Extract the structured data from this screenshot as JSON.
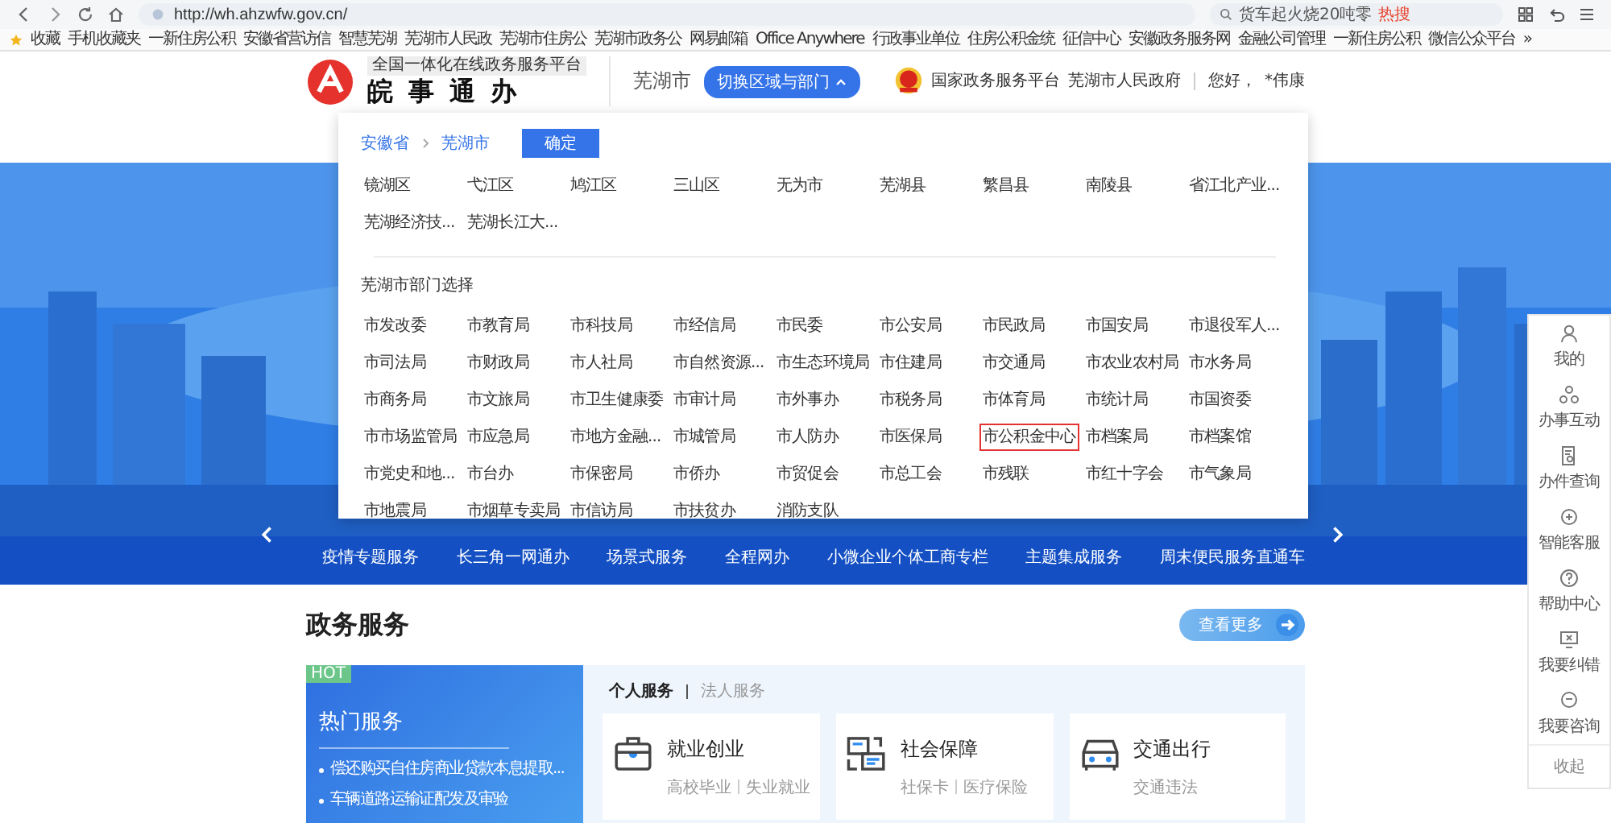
{
  "browser": {
    "url": "http://wh.ahzwfw.gov.cn/",
    "search": "货车起火烧20吨零",
    "search_badge": "热搜",
    "bookmarks": [
      "收藏",
      "手机收藏夹",
      "一新住房公积",
      "安徽省营访信",
      "智慧芜湖",
      "芜湖市人民政",
      "芜湖市住房公",
      "芜湖市政务公",
      "网易邮箱",
      "Office Anywhere",
      "行政事业单位",
      "住房公积金统",
      "征信中心",
      "安徽政务服务网",
      "金融公司管理",
      "一新住房公积",
      "微信公众平台",
      "»"
    ]
  },
  "header": {
    "tagline": "全国一体化在线政务服务平台",
    "logo_text": "皖 事 通 办",
    "city": "芜湖市",
    "switch_button": "切换区域与部门",
    "links": [
      "国家政务服务平台",
      "芜湖市人民政府"
    ],
    "greeting": "您好，",
    "user": "*伟康"
  },
  "picker": {
    "breadcrumb": [
      "安徽省",
      "芜湖市"
    ],
    "confirm": "确定",
    "regions": [
      "镜湖区",
      "弋江区",
      "鸠江区",
      "三山区",
      "无为市",
      "芜湖县",
      "繁昌县",
      "南陵县",
      "省江北产业...",
      "芜湖经济技...",
      "芜湖长江大..."
    ],
    "dept_title": "芜湖市部门选择",
    "departments": [
      {
        "label": "市发改委",
        "selected": false
      },
      {
        "label": "市教育局",
        "selected": false
      },
      {
        "label": "市科技局",
        "selected": false
      },
      {
        "label": "市经信局",
        "selected": false
      },
      {
        "label": "市民委",
        "selected": false
      },
      {
        "label": "市公安局",
        "selected": false
      },
      {
        "label": "市民政局",
        "selected": false
      },
      {
        "label": "市国安局",
        "selected": false
      },
      {
        "label": "市退役军人...",
        "selected": false
      },
      {
        "label": "市司法局",
        "selected": false
      },
      {
        "label": "市财政局",
        "selected": false
      },
      {
        "label": "市人社局",
        "selected": false
      },
      {
        "label": "市自然资源...",
        "selected": false
      },
      {
        "label": "市生态环境局",
        "selected": false
      },
      {
        "label": "市住建局",
        "selected": false
      },
      {
        "label": "市交通局",
        "selected": false
      },
      {
        "label": "市农业农村局",
        "selected": false
      },
      {
        "label": "市水务局",
        "selected": false
      },
      {
        "label": "市商务局",
        "selected": false
      },
      {
        "label": "市文旅局",
        "selected": false
      },
      {
        "label": "市卫生健康委",
        "selected": false
      },
      {
        "label": "市审计局",
        "selected": false
      },
      {
        "label": "市外事办",
        "selected": false
      },
      {
        "label": "市税务局",
        "selected": false
      },
      {
        "label": "市体育局",
        "selected": false
      },
      {
        "label": "市统计局",
        "selected": false
      },
      {
        "label": "市国资委",
        "selected": false
      },
      {
        "label": "市市场监管局",
        "selected": false
      },
      {
        "label": "市应急局",
        "selected": false
      },
      {
        "label": "市地方金融...",
        "selected": false
      },
      {
        "label": "市城管局",
        "selected": false
      },
      {
        "label": "市人防办",
        "selected": false
      },
      {
        "label": "市医保局",
        "selected": false
      },
      {
        "label": "市公积金中心",
        "selected": true
      },
      {
        "label": "市档案局",
        "selected": false
      },
      {
        "label": "市档案馆",
        "selected": false
      },
      {
        "label": "市党史和地...",
        "selected": false
      },
      {
        "label": "市台办",
        "selected": false
      },
      {
        "label": "市保密局",
        "selected": false
      },
      {
        "label": "市侨办",
        "selected": false
      },
      {
        "label": "市贸促会",
        "selected": false
      },
      {
        "label": "市总工会",
        "selected": false
      },
      {
        "label": "市残联",
        "selected": false
      },
      {
        "label": "市红十字会",
        "selected": false
      },
      {
        "label": "市气象局",
        "selected": false
      },
      {
        "label": "市地震局",
        "selected": false
      },
      {
        "label": "市烟草专卖局",
        "selected": false
      },
      {
        "label": "市信访局",
        "selected": false
      },
      {
        "label": "市扶贫办",
        "selected": false
      },
      {
        "label": "消防支队",
        "selected": false
      }
    ]
  },
  "banner": {
    "services": [
      "疫情专题服务",
      "长三角一网通办",
      "场景式服务",
      "全程网办",
      "小微企业个体工商专栏",
      "主题集成服务",
      "周末便民服务直通车"
    ]
  },
  "section": {
    "title": "政务服务",
    "more": "查看更多"
  },
  "hot": {
    "badge": "HOT",
    "title": "热门服务",
    "items": [
      "偿还购买自住房商业贷款本息提取...",
      "车辆道路运输证配发及审验"
    ]
  },
  "tabs": [
    {
      "label": "个人服务",
      "selected": true
    },
    {
      "label": "法人服务",
      "selected": false
    }
  ],
  "categories": [
    {
      "kind": "briefcase",
      "title": "就业创业",
      "tags": [
        "高校毕业",
        "失业就业"
      ]
    },
    {
      "kind": "forms",
      "title": "社会保障",
      "tags": [
        "社保卡",
        "医疗保险"
      ]
    },
    {
      "kind": "car",
      "title": "交通出行",
      "tags": [
        "交通违法"
      ]
    }
  ],
  "sidebar": [
    {
      "kind": "user",
      "label": "我的"
    },
    {
      "kind": "interact",
      "label": "办事互动"
    },
    {
      "kind": "query",
      "label": "办件查询"
    },
    {
      "kind": "service",
      "label": "智能客服"
    },
    {
      "kind": "help",
      "label": "帮助中心"
    },
    {
      "kind": "report",
      "label": "我要纠错"
    },
    {
      "kind": "consult",
      "label": "我要咨询"
    },
    {
      "kind": "text",
      "label": "收起"
    }
  ]
}
